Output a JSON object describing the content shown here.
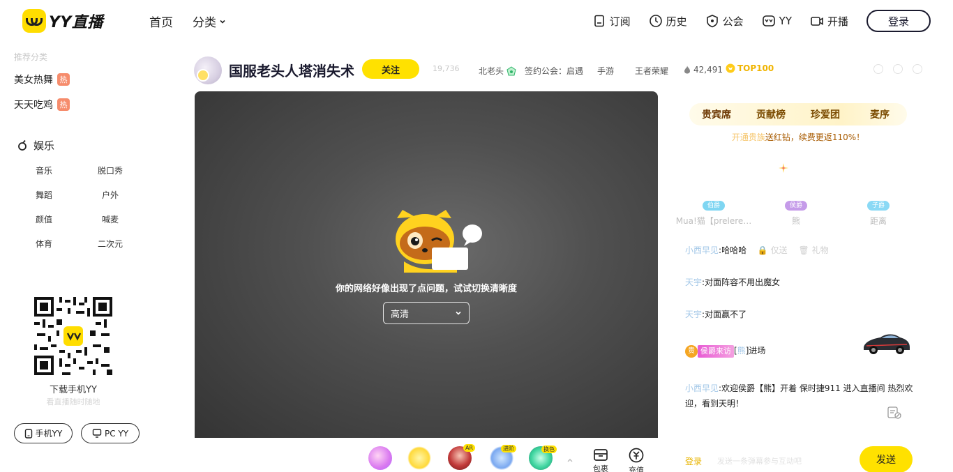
{
  "header": {
    "logo_text": "YY直播",
    "nav_home": "首页",
    "nav_category": "分类",
    "right_items": [
      {
        "label": "订阅",
        "icon": "bookmark-icon"
      },
      {
        "label": "历史",
        "icon": "clock-icon"
      },
      {
        "label": "公会",
        "icon": "guild-icon"
      },
      {
        "label": "YY",
        "icon": "yy-icon"
      },
      {
        "label": "开播",
        "icon": "camera-icon"
      }
    ],
    "login_label": "登录"
  },
  "sidebar": {
    "faded_heading": "推荐分类",
    "hot_items": [
      {
        "label": "美女热舞",
        "badge": "热"
      },
      {
        "label": "天天吃鸡",
        "badge": "热"
      }
    ],
    "entertainment_label": "娱乐",
    "entertainment_items": [
      "音乐",
      "脱口秀",
      "舞蹈",
      "户外",
      "颜值",
      "喊麦",
      "体育",
      "二次元"
    ],
    "qr_label": "下载手机YY",
    "qr_sub": "看直播随时随地",
    "download_buttons": [
      "手机YY",
      "PC YY"
    ]
  },
  "room": {
    "title": "国服老头人塔消失术",
    "follow_label": "关注",
    "room_id": "19,736",
    "anchor_name": "北老头",
    "guild": "签约公会：启遇",
    "category": "手游",
    "game": "王者荣耀",
    "heat": "42,491",
    "rank": "TOP100"
  },
  "player": {
    "error_message": "你的网络好像出现了点问题，试试切换清晰度",
    "quality": "高清"
  },
  "giftbar": {
    "tags": [
      "AR",
      "进阶",
      "换色"
    ],
    "bag_label": "包裹",
    "recharge_label": "充值"
  },
  "panel": {
    "tabs": [
      "贵宾席",
      "贡献榜",
      "珍爱团",
      "麦序"
    ],
    "promo_highlight": "开通贵族",
    "promo_text": "送红钻，续费更返110%！",
    "vip_seats": [
      {
        "badge": "伯爵",
        "name": "Mua!猫【prelere…",
        "color": "#7fd6f2"
      },
      {
        "badge": "侯爵",
        "name": "熊",
        "color": "#c59be9"
      },
      {
        "badge": "子爵",
        "name": "距离",
        "color": "#8ad9f5"
      }
    ],
    "chat": [
      {
        "nick": "小西早见",
        "text": "哈哈哈",
        "extra1": "仅送",
        "extra2": "礼物"
      },
      {
        "nick": "天宇",
        "text": "对面阵容不用出魔女"
      },
      {
        "nick": "天宇",
        "text": "对面赢不了"
      },
      {
        "badge": "贵",
        "tag": "侯爵来访",
        "nick": "熊",
        "text": "进场"
      },
      {
        "nick": "小西早见",
        "text": "欢迎侯爵【熊】开着 保时捷911 进入直播间 热烈欢迎，看到天明！"
      }
    ],
    "login_prompt": "登录",
    "input_placeholder": "发送一条弹幕参与互动吧",
    "send_label": "发送"
  }
}
